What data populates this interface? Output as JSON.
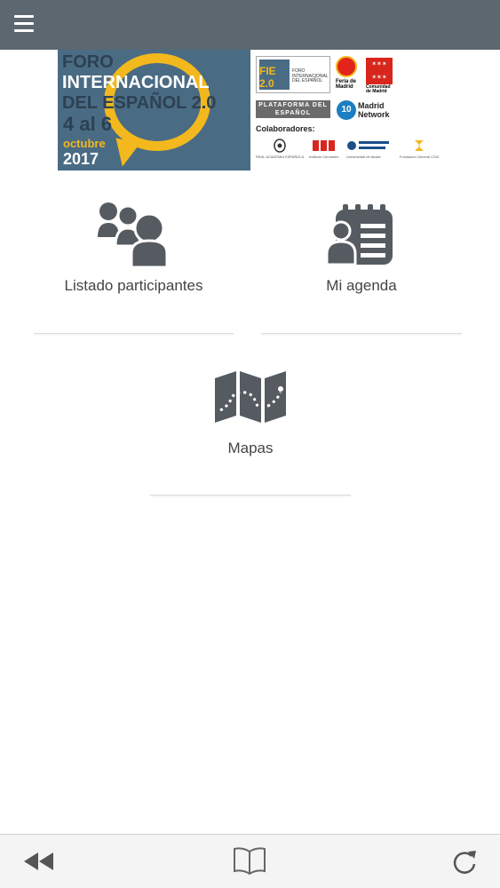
{
  "banner": {
    "line1": "FORO",
    "line2": "INTERNACIONAL",
    "line3": "DEL ESPAÑOL 2.0",
    "dates": "4 al 6",
    "month": "octubre",
    "year": "2017",
    "fie_mark": "FIE 2.0",
    "fie_text": "FORO INTERNACIONAL DEL ESPAÑOL",
    "ifema": "Feria de Madrid",
    "cam": "Comunidad de Madrid",
    "plataforma": "PLATAFORMA DEL ESPAÑOL",
    "madrid_network_num": "10",
    "madrid_network": "Madrid Network",
    "colaboradores": "Colaboradores:",
    "colab1": "REAL ACADEMIA ESPAÑOLA",
    "colab2": "Instituto Cervantes",
    "colab3": "Universidad de Alcalá",
    "colab4": "Fundación General CSIC"
  },
  "tiles": {
    "participants": "Listado participantes",
    "agenda": "Mi agenda",
    "maps": "Mapas"
  },
  "colors": {
    "topbar": "#5c6770",
    "icon": "#555b61",
    "accent_yellow": "#f2b81d",
    "banner_blue": "#4a6b84"
  },
  "icons": {
    "menu": "hamburger-menu-icon",
    "participants": "people-icon",
    "agenda": "agenda-icon",
    "maps": "map-icon",
    "back": "rewind-icon",
    "bookmarks": "open-book-icon",
    "reload": "reload-icon"
  }
}
